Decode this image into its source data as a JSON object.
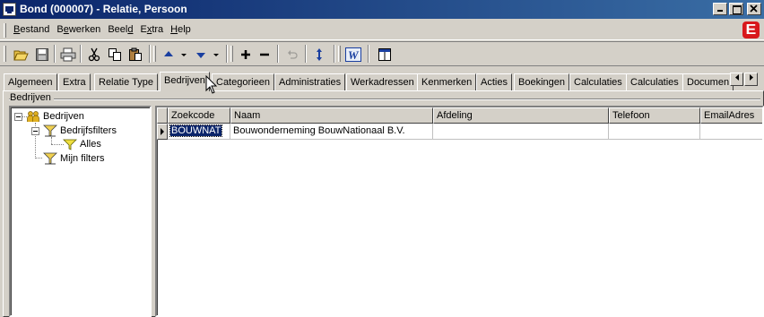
{
  "window": {
    "title": "Bond (000007) - Relatie, Persoon"
  },
  "menu": {
    "items": [
      {
        "label": "Bestand",
        "accel": "B",
        "rest": "estand"
      },
      {
        "label": "Bewerken",
        "accel": "e",
        "pre": "B",
        "rest": "werken"
      },
      {
        "label": "Beeld",
        "accel": "d",
        "pre": "Beel",
        "rest": ""
      },
      {
        "label": "Extra",
        "accel": "x",
        "pre": "E",
        "rest": "tra"
      },
      {
        "label": "Help",
        "accel": "H",
        "pre": "",
        "rest": "elp"
      }
    ],
    "brand_letter": "E",
    "brand_color": "#d8181c"
  },
  "toolbar": {
    "buttons": [
      "open-icon",
      "save-icon",
      "print-icon",
      "cut-icon",
      "copy-icon",
      "paste-icon",
      "arrow-up-icon",
      "arrow-up-dropdown",
      "arrow-down-icon",
      "arrow-down-dropdown",
      "add-icon",
      "remove-icon",
      "undo-icon",
      "refresh-icon",
      "word-icon",
      "window-icon"
    ]
  },
  "tabs": [
    "Algemeen",
    "Extra",
    "Relatie Type",
    "Bedrijven",
    "Categorieen",
    "Administraties",
    "Werkadressen",
    "Kenmerken",
    "Acties",
    "Boekingen",
    "Calculaties",
    "Calculaties",
    "Documen"
  ],
  "active_tab": "Bedrijven",
  "group": {
    "label": "Bedrijven"
  },
  "tree": {
    "root": "Bedrijven",
    "filters": "Bedrijfsfilters",
    "filter_all": "Alles",
    "my_filters": "Mijn filters"
  },
  "grid": {
    "columns": [
      "Zoekcode",
      "Naam",
      "Afdeling",
      "Telefoon",
      "EmailAdres"
    ],
    "rows": [
      {
        "zoekcode": "BOUWNAT",
        "naam": "Bouwonderneming BouwNationaal B.V.",
        "afdeling": "",
        "telefoon": "",
        "email": ""
      }
    ]
  },
  "colors": {
    "title_start": "#0a246a",
    "title_end": "#3a6ea5",
    "face": "#d4d0c8",
    "selection": "#0a246a"
  }
}
